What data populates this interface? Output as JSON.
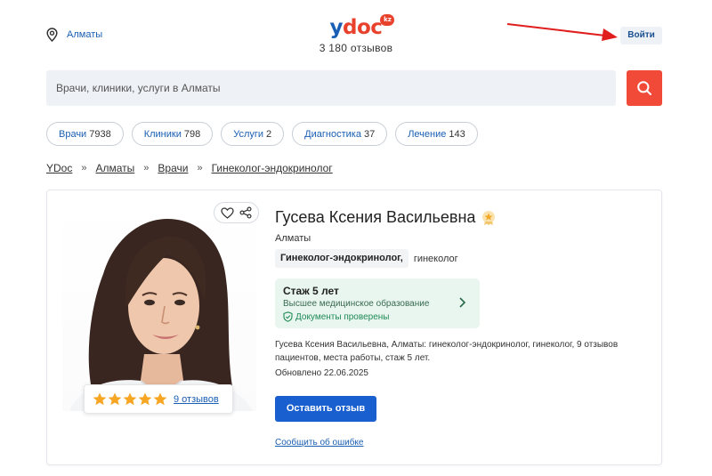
{
  "header": {
    "location": "Алматы",
    "logo": {
      "main": "y",
      "accent": "doc",
      "badge": "kz"
    },
    "reviews_count": "3 180 отзывов",
    "login_label": "Войти"
  },
  "search": {
    "placeholder": "Врачи, клиники, услуги в Алматы"
  },
  "chips": [
    {
      "label": "Врачи",
      "count": "7938"
    },
    {
      "label": "Клиники",
      "count": "798"
    },
    {
      "label": "Услуги",
      "count": "2"
    },
    {
      "label": "Диагностика",
      "count": "37"
    },
    {
      "label": "Лечение",
      "count": "143"
    }
  ],
  "breadcrumb": {
    "items": [
      "YDoc",
      "Алматы",
      "Врачи",
      "Гинеколог-эндокринолог"
    ],
    "separator": "»"
  },
  "doctor": {
    "name": "Гусева Ксения Васильевна",
    "city": "Алматы",
    "specialties": [
      "Гинеколог-эндокринолог,",
      "гинеколог"
    ],
    "experience": {
      "title": "Стаж 5 лет",
      "education": "Высшее медицинское образование",
      "verified": "Документы проверены"
    },
    "description": "Гусева Ксения Васильевна, Алматы: гинеколог-эндокринолог, гинеколог, 9 отзывов пациентов, места работы, стаж 5 лет.",
    "updated": "Обновлено 22.06.2025",
    "rating": {
      "stars": 5,
      "reviews_link": "9 отзывов"
    },
    "leave_review_label": "Оставить отзыв",
    "report_error_label": "Сообщить об ошибке"
  },
  "colors": {
    "brand_blue": "#1a5fb4",
    "brand_red": "#e8412c",
    "search_button": "#f24a38",
    "primary_button": "#1a5fcf",
    "experience_bg": "#e8f6ef",
    "star": "#f6a623",
    "annotation_arrow": "#e01e1e"
  },
  "icons": [
    "location-pin-icon",
    "search-icon",
    "heart-icon",
    "share-icon",
    "award-badge-icon",
    "star-icon",
    "shield-check-icon",
    "chevron-right-icon"
  ]
}
